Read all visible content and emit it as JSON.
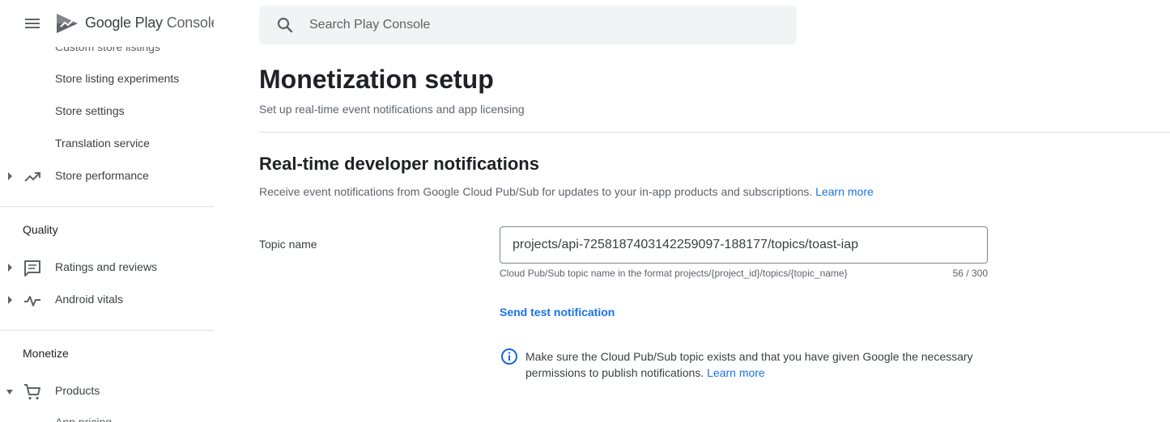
{
  "app": {
    "brand_google_play": "Google Play",
    "brand_console": "Console"
  },
  "search": {
    "placeholder": "Search Play Console"
  },
  "sidebar": {
    "cutoff_top": "Custom store listings",
    "items": [
      {
        "label": "Store listing experiments"
      },
      {
        "label": "Store settings"
      },
      {
        "label": "Translation service"
      },
      {
        "label": "Store performance"
      }
    ],
    "quality": {
      "title": "Quality",
      "items": [
        {
          "label": "Ratings and reviews"
        },
        {
          "label": "Android vitals"
        }
      ]
    },
    "monetize": {
      "title": "Monetize",
      "items": [
        {
          "label": "Products"
        }
      ]
    },
    "cutoff_bottom": "App pricing"
  },
  "main": {
    "title": "Monetization setup",
    "subtitle": "Set up real-time event notifications and app licensing",
    "rtdn": {
      "heading": "Real-time developer notifications",
      "description": "Receive event notifications from Google Cloud Pub/Sub for updates to your in-app products and subscriptions.",
      "learn_more": "Learn more",
      "topic_label": "Topic name",
      "topic_value": "projects/api-7258187403142259097-188177/topics/toast-iap",
      "helper": "Cloud Pub/Sub topic name in the format projects/{project_id}/topics/{topic_name}",
      "counter": "56 / 300",
      "send_test": "Send test notification",
      "info_text": "Make sure the Cloud Pub/Sub topic exists and that you have given Google the necessary permissions to publish notifications.",
      "info_learn_more": "Learn more"
    }
  },
  "colors": {
    "accent": "#1a73e8",
    "text_primary": "#202124",
    "text_secondary": "#5f6368",
    "search_bg": "#f1f3f4"
  },
  "icons": {
    "menu": "hamburger-icon",
    "search": "search-icon",
    "store_performance": "trending-up-icon",
    "ratings": "comment-icon",
    "vitals": "pulse-icon",
    "products": "cart-icon",
    "info": "info-icon"
  }
}
